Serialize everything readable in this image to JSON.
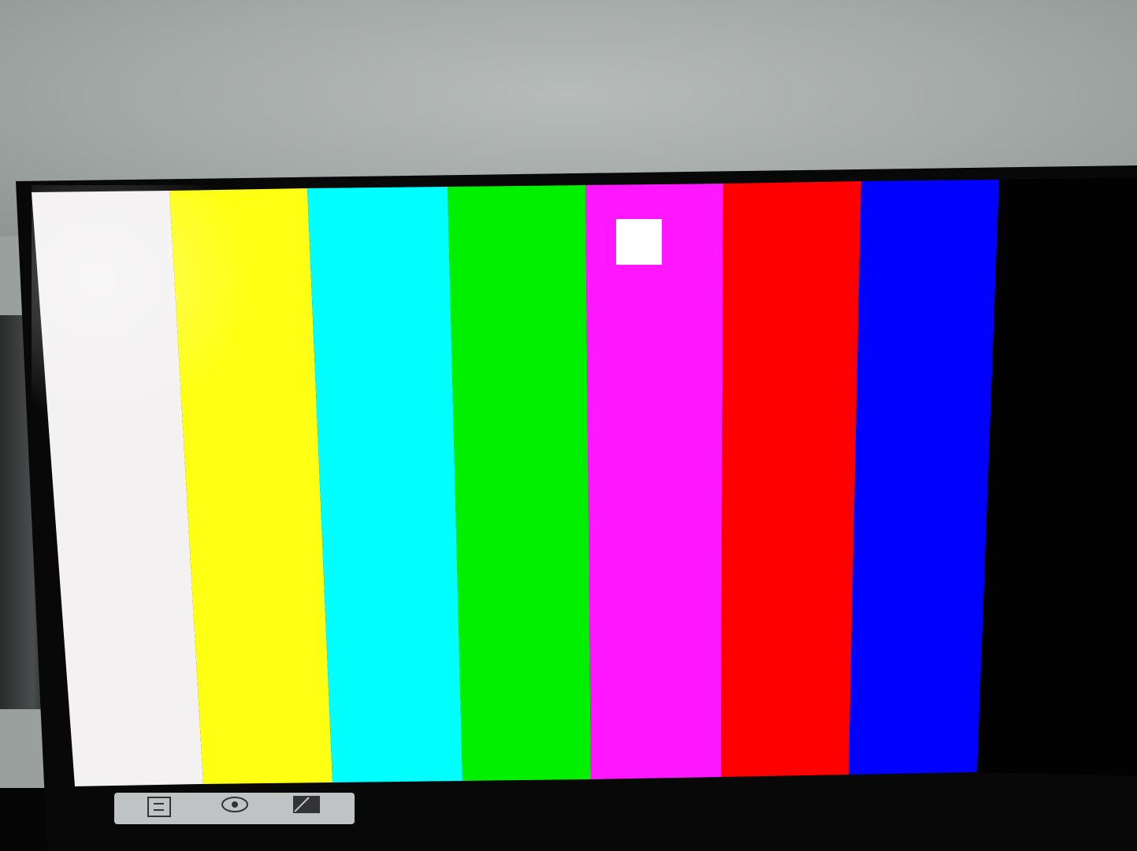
{
  "scene": {
    "subject": "monitor-color-bar-test-pattern",
    "colors": {
      "wall": "#a7adab",
      "bezel": "#080808",
      "white": "#f3f1f1",
      "yellow": "#ffff14",
      "cyan": "#00ffff",
      "green": "#00f000",
      "magenta": "#ff17ff",
      "red": "#ff0000",
      "blue": "#0000ff",
      "marker": "#ffffff",
      "osd_strip": "#bfc3c4"
    },
    "bars": [
      {
        "name": "white",
        "color": "#f3f1f1"
      },
      {
        "name": "yellow",
        "color": "#ffff14"
      },
      {
        "name": "cyan",
        "color": "#00ffff"
      },
      {
        "name": "green",
        "color": "#00f000"
      },
      {
        "name": "magenta",
        "color": "#ff17ff"
      },
      {
        "name": "red",
        "color": "#ff0000"
      },
      {
        "name": "blue",
        "color": "#0000ff"
      }
    ],
    "osd_icons": [
      "input-source-icon",
      "eye-icon",
      "picture-mode-icon"
    ]
  }
}
